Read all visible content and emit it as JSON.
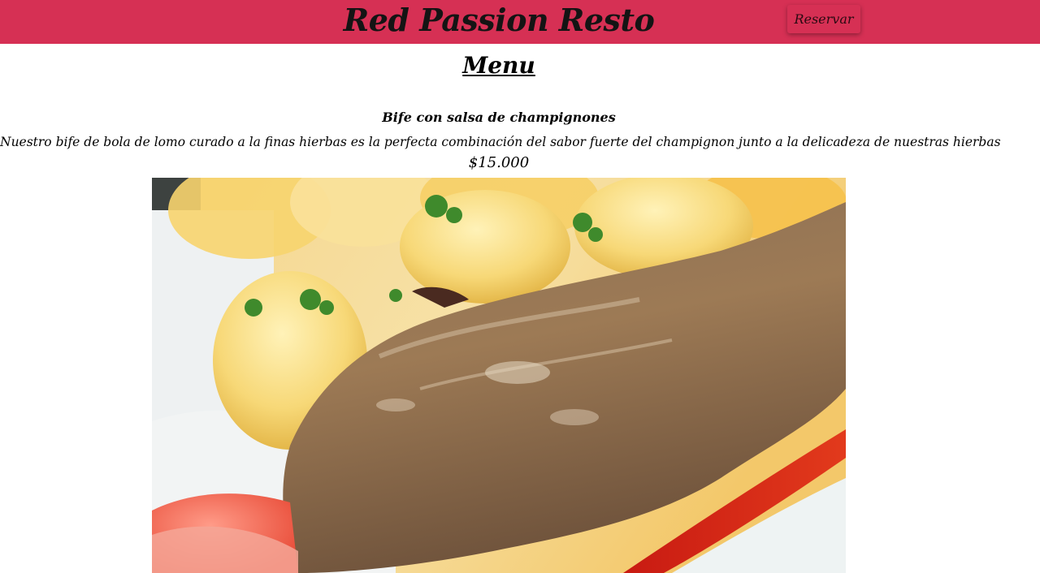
{
  "header": {
    "brand": "Red Passion Resto",
    "reserve_label": "Reservar"
  },
  "menu": {
    "title": "Menu",
    "dish": {
      "name": "Bife con salsa de champignones",
      "description": "Nuestro bife de bola de lomo curado a la finas hierbas es la perfecta combinación del sabor fuerte del champignon junto a la delicadeza de nuestras hierbas",
      "price": "$15.000"
    }
  },
  "colors": {
    "brand_red": "#d63054",
    "text": "#000000"
  }
}
